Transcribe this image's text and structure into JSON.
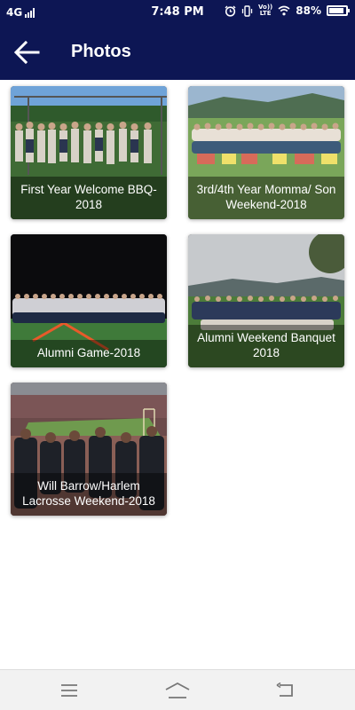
{
  "status_bar": {
    "network": "4G",
    "time": "7:48 PM",
    "volte_top": "Vo))",
    "volte_bottom": "LTE",
    "battery_percent_text": "88%",
    "battery_level": 0.88
  },
  "app_bar": {
    "title": "Photos",
    "back_icon": "arrow-left-icon"
  },
  "albums": [
    {
      "title": "First Year Welcome BBQ-2018"
    },
    {
      "title": "3rd/4th Year Momma/ Son Weekend-2018"
    },
    {
      "title": "Alumni Game-2018"
    },
    {
      "title": "Alumni Weekend Banquet 2018"
    },
    {
      "title": "Will Barrow/Harlem Lacrosse Weekend-2018"
    }
  ],
  "nav_bar": {
    "menu_icon": "menu-icon",
    "home_icon": "home-icon",
    "back_icon": "back-icon"
  },
  "colors": {
    "header": "#0d1654",
    "navbar": "#f2f2f2"
  }
}
